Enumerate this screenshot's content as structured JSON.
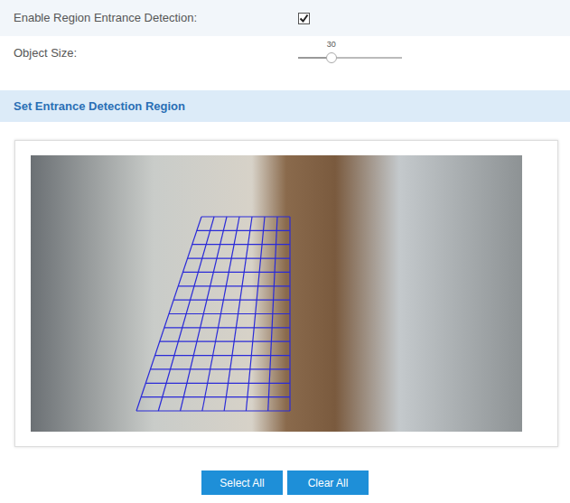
{
  "form": {
    "fields": [
      {
        "kind": "checkbox",
        "label": "Enable Region Entrance Detection:",
        "checked": true
      },
      {
        "kind": "slider",
        "label": "Object Size:",
        "value": "30",
        "level": 0.32
      }
    ]
  },
  "section": {
    "title": "Set Entrance Detection Region"
  },
  "buttons": [
    {
      "label": "Select All"
    },
    {
      "label": "Clear All"
    }
  ]
}
